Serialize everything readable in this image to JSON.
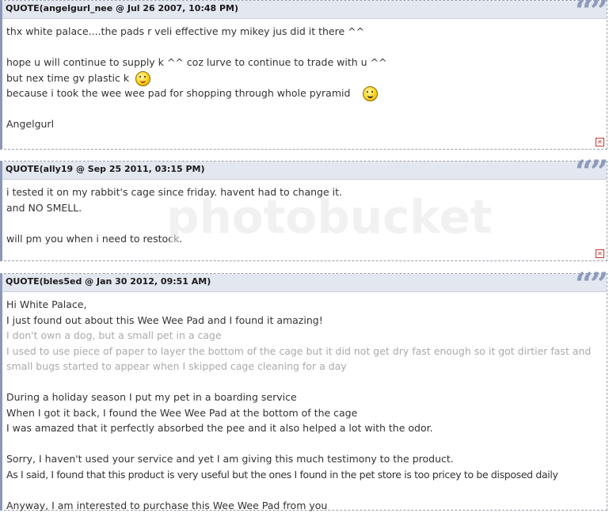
{
  "quotes": [
    {
      "title": "QUOTE(angelgurl_nee @ Jul 26 2007, 10:48 PM)",
      "lines": [
        "thx white palace....the pads r veli effective my mikey jus did it there ^^",
        "",
        "hope u will continue to supply k ^^ coz lurve to continue to trade with u ^^",
        "but nex time gv plastic k",
        "because i took the wee wee pad for shopping through whole pyramid",
        "",
        "Angelgurl"
      ]
    },
    {
      "title": "QUOTE(ally19 @ Sep 25 2011, 03:15 PM)",
      "lines": [
        "i tested it on my rabbit's cage since friday. havent had to change it.",
        "and NO SMELL.",
        "",
        "will pm you when i need to restock."
      ]
    },
    {
      "title": "QUOTE(bles5ed @ Jan 30 2012, 09:51 AM)",
      "lines": [
        "Hi White Palace,",
        "I just found out about this Wee Wee Pad and I found it amazing!",
        "I don't own a dog, but a small pet in a cage",
        "I used to use piece of paper to layer the bottom of the cage but it did not get dry fast enough so it got dirtier fast and small bugs started to appear when I skipped cage cleaning for a day",
        "",
        "During a holiday season I put my pet in a boarding service",
        "When I got it back, I found the Wee Wee Pad at the bottom of the cage",
        "I was amazed that it perfectly absorbed the pee and it also helped a lot with the odor.",
        "",
        "Sorry, I haven't used your service and yet I am giving this much testimony to the product.",
        "As I said, I found that this product is very useful but the ones I found in the pet store is too pricey to be disposed daily",
        "",
        "Anyway, I am interested to purchase this Wee Wee Pad from you"
      ]
    }
  ],
  "quote_mark": "“”",
  "report_icon": "report-icon"
}
